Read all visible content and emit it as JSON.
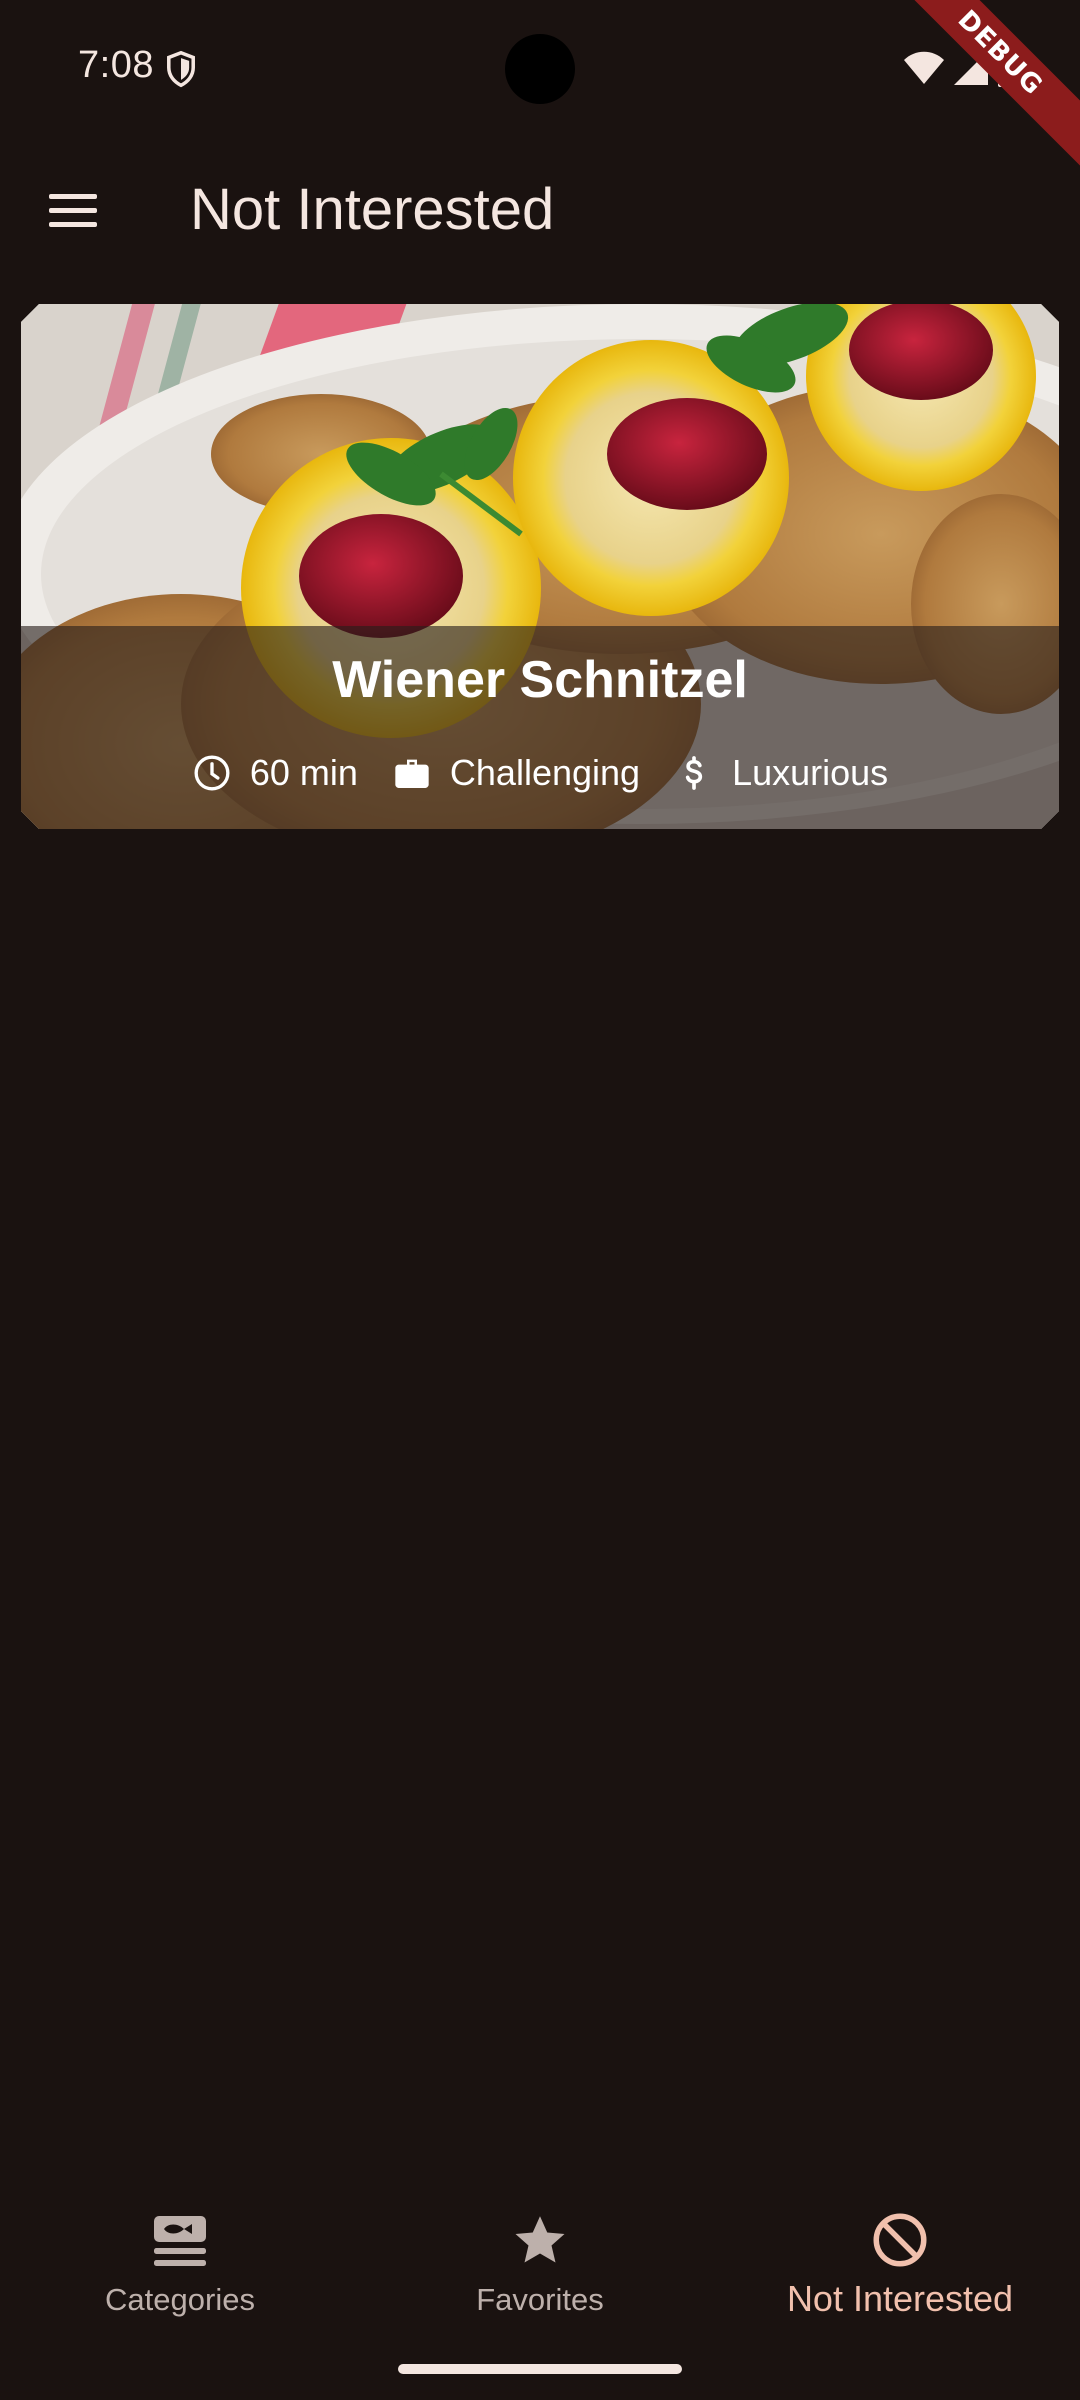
{
  "status_bar": {
    "time": "7:08",
    "debug_label": "DEBUG"
  },
  "app_bar": {
    "title": "Not Interested"
  },
  "meals": [
    {
      "title": "Wiener Schnitzel",
      "duration": "60 min",
      "complexity": "Challenging",
      "affordability": "Luxurious"
    }
  ],
  "bottom_nav": {
    "items": [
      {
        "label": "Categories",
        "icon": "categories-icon"
      },
      {
        "label": "Favorites",
        "icon": "star-icon"
      },
      {
        "label": "Not Interested",
        "icon": "block-icon"
      }
    ],
    "active_index": 2
  },
  "colors": {
    "background": "#1a1210",
    "text_primary": "#f4e6e0",
    "nav_inactive": "#bdb0ab",
    "nav_active": "#f1c0ad",
    "debug_banner": "#8c1c1c"
  }
}
